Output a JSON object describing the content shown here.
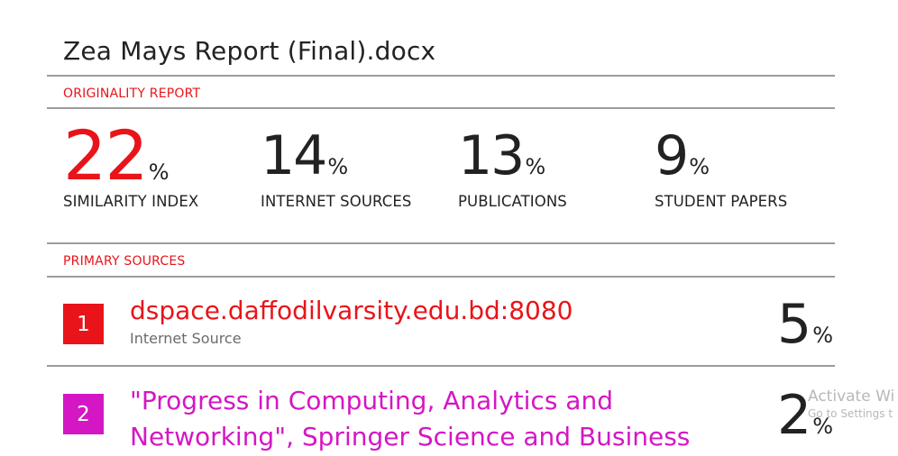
{
  "document": {
    "title": "Zea Mays Report (Final).docx"
  },
  "originality": {
    "heading": "ORIGINALITY REPORT",
    "stats": [
      {
        "value": "22",
        "unit": "%",
        "label": "SIMILARITY INDEX"
      },
      {
        "value": "14",
        "unit": "%",
        "label": "INTERNET SOURCES"
      },
      {
        "value": "13",
        "unit": "%",
        "label": "PUBLICATIONS"
      },
      {
        "value": "9",
        "unit": "%",
        "label": "STUDENT PAPERS"
      }
    ]
  },
  "primary_sources": {
    "heading": "PRIMARY SOURCES",
    "items": [
      {
        "rank": "1",
        "title": "dspace.daffodilvarsity.edu.bd:8080",
        "type": "Internet Source",
        "percent": "5",
        "unit": "%",
        "color": "#e8141a"
      },
      {
        "rank": "2",
        "title_line1": "\"Progress in Computing, Analytics and",
        "title_line2": "Networking\", Springer Science and Business",
        "percent": "2",
        "unit": "%",
        "color": "#d516c4"
      }
    ]
  },
  "watermark": {
    "line1": "Activate Wi",
    "line2": "Go to Settings t"
  },
  "colors": {
    "accent": "#e8141a",
    "magenta": "#d516c4",
    "rule": "#9c9c9c"
  }
}
